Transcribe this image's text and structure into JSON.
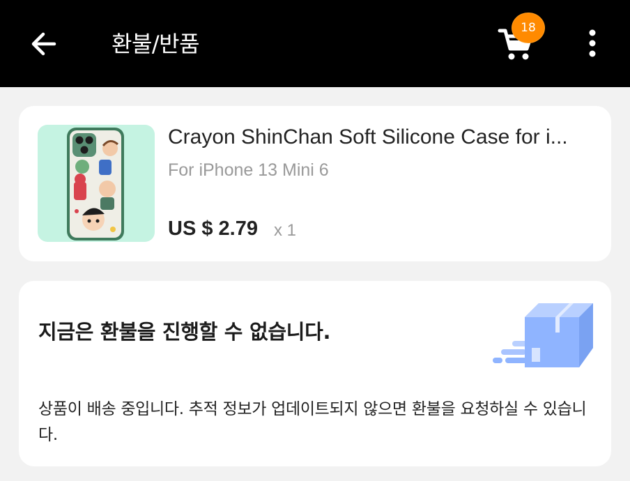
{
  "header": {
    "title": "환불/반품",
    "cart_count": "18",
    "icons": {
      "back": "back-arrow-icon",
      "cart": "cart-icon",
      "more": "more-vertical-icon"
    }
  },
  "product": {
    "title": "Crayon ShinChan Soft Silicone Case for i...",
    "variant": "For iPhone 13 Mini 6",
    "price": "US $ 2.79",
    "quantity": "x 1"
  },
  "status": {
    "heading": "지금은 환불을 진행할 수 없습니다.",
    "description": "상품이 배송 중입니다. 추적 정보가 업데이트되지 않으면 환불을 요청하실 수 있습니다."
  },
  "colors": {
    "header_bg": "#000000",
    "badge": "#ff8a00",
    "thumb_bg": "#c5f3e2",
    "box_blue": "#8fb4ff"
  }
}
